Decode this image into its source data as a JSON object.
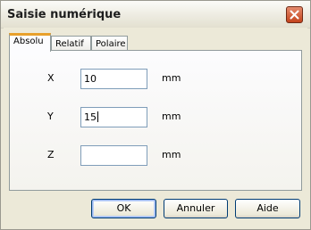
{
  "window": {
    "title": "Saisie numérique"
  },
  "tabs": [
    {
      "label": "Absolu",
      "active": true
    },
    {
      "label": "Relatif",
      "active": false
    },
    {
      "label": "Polaire",
      "active": false
    }
  ],
  "fields": [
    {
      "label": "X",
      "value": "10",
      "unit": "mm"
    },
    {
      "label": "Y",
      "value": "15",
      "unit": "mm"
    },
    {
      "label": "Z",
      "value": "",
      "unit": "mm"
    }
  ],
  "buttons": {
    "ok": "OK",
    "cancel": "Annuler",
    "help": "Aide"
  },
  "icons": {
    "close": "close-icon"
  },
  "colors": {
    "active_tab_accent": "#e8a02b",
    "close_button": "#c4431c"
  }
}
